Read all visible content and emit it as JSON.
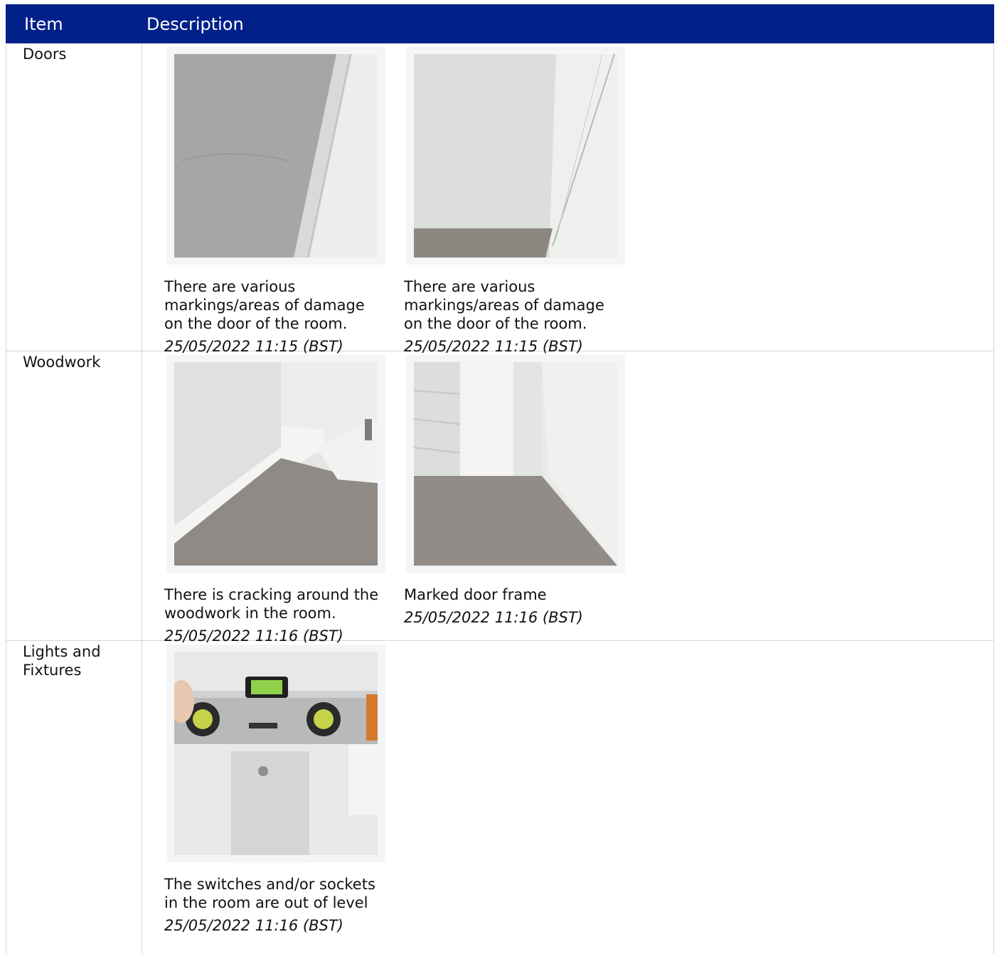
{
  "header": {
    "item": "Item",
    "description": "Description"
  },
  "rows": [
    {
      "label": "Doors",
      "photos": [
        {
          "caption": "There are various markings/areas of damage on the door of the room.",
          "timestamp": "25/05/2022 11:15 (BST)"
        },
        {
          "caption": "There are various markings/areas of damage on the door of the room.",
          "timestamp": "25/05/2022 11:15 (BST)"
        }
      ]
    },
    {
      "label": "Woodwork",
      "photos": [
        {
          "caption": "There is cracking around the woodwork in the room.",
          "timestamp": "25/05/2022 11:16 (BST)"
        },
        {
          "caption": "Marked door frame",
          "timestamp": "25/05/2022 11:16 (BST)"
        }
      ]
    },
    {
      "label": "Lights and Fixtures",
      "photos": [
        {
          "caption": "The switches and/or sockets in the room are out of level",
          "timestamp": "25/05/2022 11:16 (BST)"
        }
      ]
    }
  ]
}
